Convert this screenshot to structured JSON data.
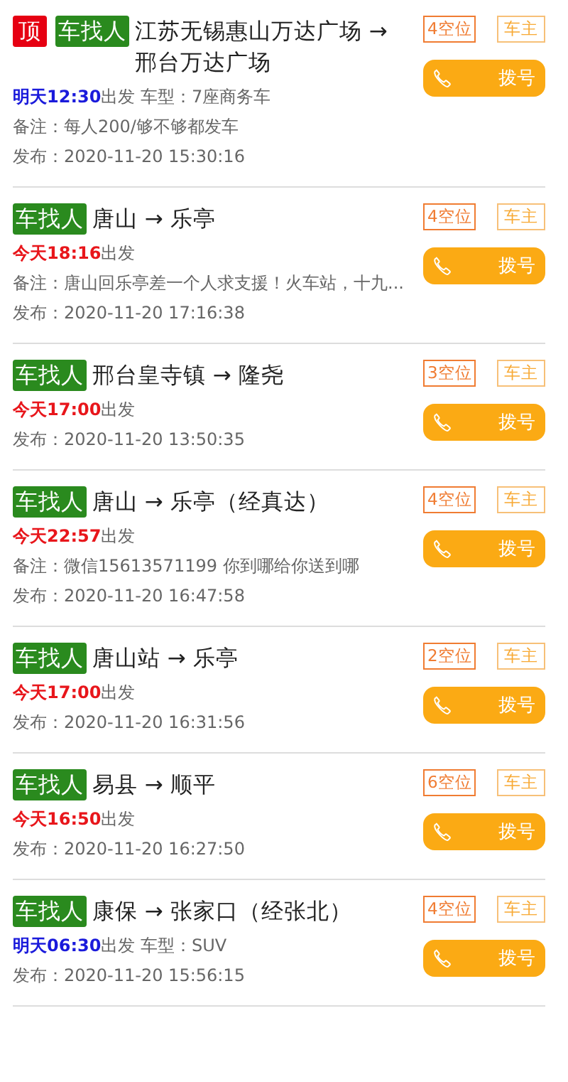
{
  "posts": [
    {
      "pinned": true,
      "pinned_label": "顶",
      "tag": "车找人",
      "route": "江苏无锡惠山万达广场 → 邢台万达广场",
      "seats": "4空位",
      "role": "车主",
      "time": "明天12:30",
      "color": "#1a1adb",
      "depart": "出发 车型：7座商务车",
      "note": "备注：每人200/够不够都发车",
      "published": "发布：2020-11-20 15:30:16",
      "dial": "拨号"
    },
    {
      "pinned": false,
      "tag": "车找人",
      "route": "唐山 → 乐亭",
      "seats": "4空位",
      "role": "车主",
      "time": "今天18:16",
      "color": "#e8161b",
      "depart": "出发",
      "note": "备注：唐山回乐亭差一个人求支援！火车站，十九...",
      "published": "发布：2020-11-20 17:16:38",
      "dial": "拨号"
    },
    {
      "pinned": false,
      "tag": "车找人",
      "route": "邢台皇寺镇 → 隆尧",
      "seats": "3空位",
      "role": "车主",
      "time": "今天17:00",
      "color": "#e8161b",
      "depart": "出发",
      "published": "发布：2020-11-20 13:50:35",
      "dial": "拨号"
    },
    {
      "pinned": false,
      "tag": "车找人",
      "route": "唐山 → 乐亭（经真达）",
      "seats": "4空位",
      "role": "车主",
      "time": "今天22:57",
      "color": "#e8161b",
      "depart": "出发",
      "note": "备注：微信15613571199 你到哪给你送到哪",
      "published": "发布：2020-11-20 16:47:58",
      "dial": "拨号"
    },
    {
      "pinned": false,
      "tag": "车找人",
      "route": "唐山站 → 乐亭",
      "seats": "2空位",
      "role": "车主",
      "time": "今天17:00",
      "color": "#e8161b",
      "depart": "出发",
      "published": "发布：2020-11-20 16:31:56",
      "dial": "拨号"
    },
    {
      "pinned": false,
      "tag": "车找人",
      "route": "易县 → 顺平",
      "seats": "6空位",
      "role": "车主",
      "time": "今天16:50",
      "color": "#e8161b",
      "depart": "出发",
      "published": "发布：2020-11-20 16:27:50",
      "dial": "拨号"
    },
    {
      "pinned": false,
      "tag": "车找人",
      "route": "康保 → 张家口（经张北）",
      "seats": "4空位",
      "role": "车主",
      "time": "明天06:30",
      "color": "#1a1adb",
      "depart": "出发 车型：SUV",
      "published": "发布：2020-11-20 15:56:15",
      "dial": "拨号"
    }
  ]
}
